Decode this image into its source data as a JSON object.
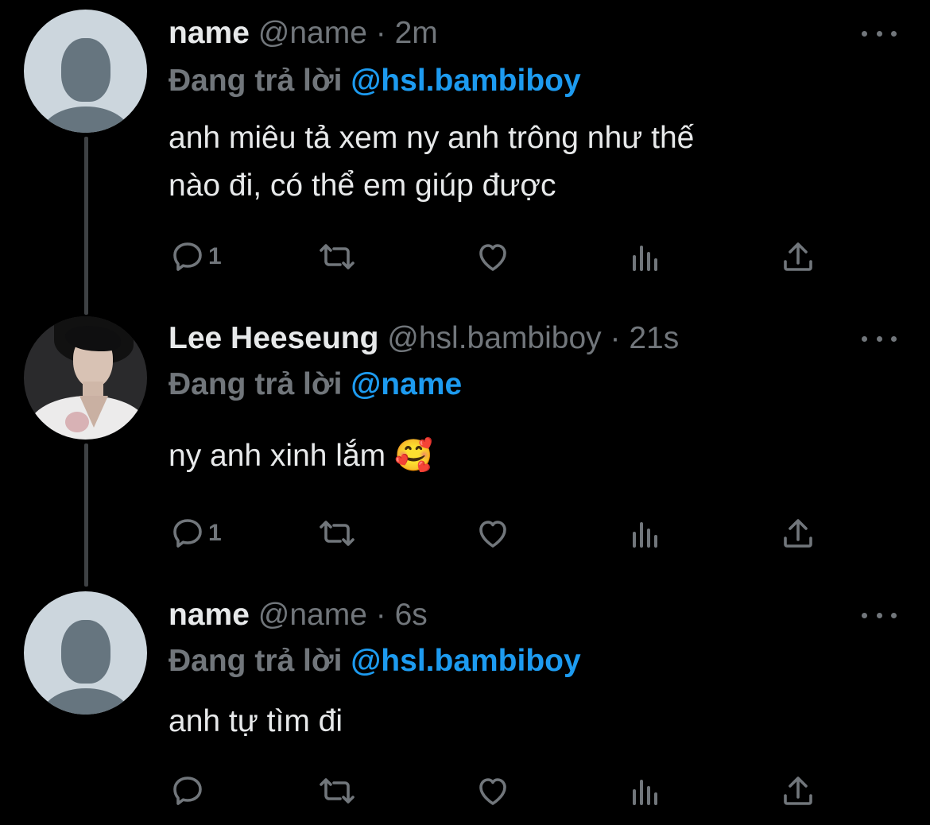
{
  "tweets": [
    {
      "display_name": "name",
      "handle": "@name",
      "separator": "·",
      "time": "2m",
      "reply_prefix": "Đang trả lời",
      "reply_to": "@hsl.bambiboy",
      "text_lines": [
        "anh miêu tả xem ny anh trông như thế",
        "nào đi, có thể em giúp được"
      ],
      "avatar": "default-avatar",
      "reply_count": "1"
    },
    {
      "display_name": "Lee Heeseung",
      "handle": "@hsl.bambiboy",
      "separator": "·",
      "time": "21s",
      "reply_prefix": "Đang trả lời",
      "reply_to": "@name",
      "text": "ny anh xinh lắm 🥰",
      "avatar": "profile-photo",
      "reply_count": "1"
    },
    {
      "display_name": "name",
      "handle": "@name",
      "separator": "·",
      "time": "6s",
      "reply_prefix": "Đang trả lời",
      "reply_to": "@hsl.bambiboy",
      "text": "anh tự tìm đi",
      "avatar": "default-avatar",
      "reply_count": ""
    }
  ],
  "icons": [
    "reply-icon",
    "retweet-icon",
    "like-icon",
    "views-icon",
    "share-icon",
    "more-icon"
  ],
  "colors": {
    "background": "#000000",
    "text": "#e7e9ea",
    "muted": "#71767b",
    "link": "#1d9bf0",
    "thread_line": "#3e4144"
  }
}
